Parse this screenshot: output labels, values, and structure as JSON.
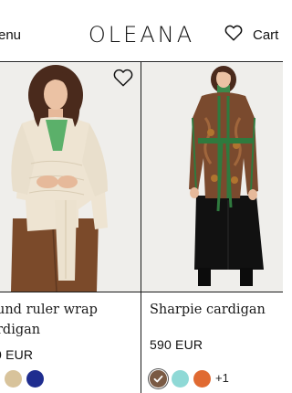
{
  "header": {
    "menu_label": "enu",
    "brand": "OLEANA",
    "wishlist_icon": "heart-outline-icon",
    "cart_label": "Cart"
  },
  "products": [
    {
      "name_line1": "und ruler wrap",
      "name_line2": "rdigan",
      "price": "0 EUR",
      "wishlist_icon": "heart-outline-icon",
      "swatches": [
        "#d8c39b",
        "#1f2d8f"
      ]
    },
    {
      "name_line1": "Sharpie cardigan",
      "price": "590 EUR",
      "wishlist_icon": "heart-outline-icon",
      "swatches": [
        "#7a5a44",
        "#8fd9d6",
        "#e06a32"
      ],
      "selected_swatch": 0,
      "more_colors": "+1"
    }
  ]
}
